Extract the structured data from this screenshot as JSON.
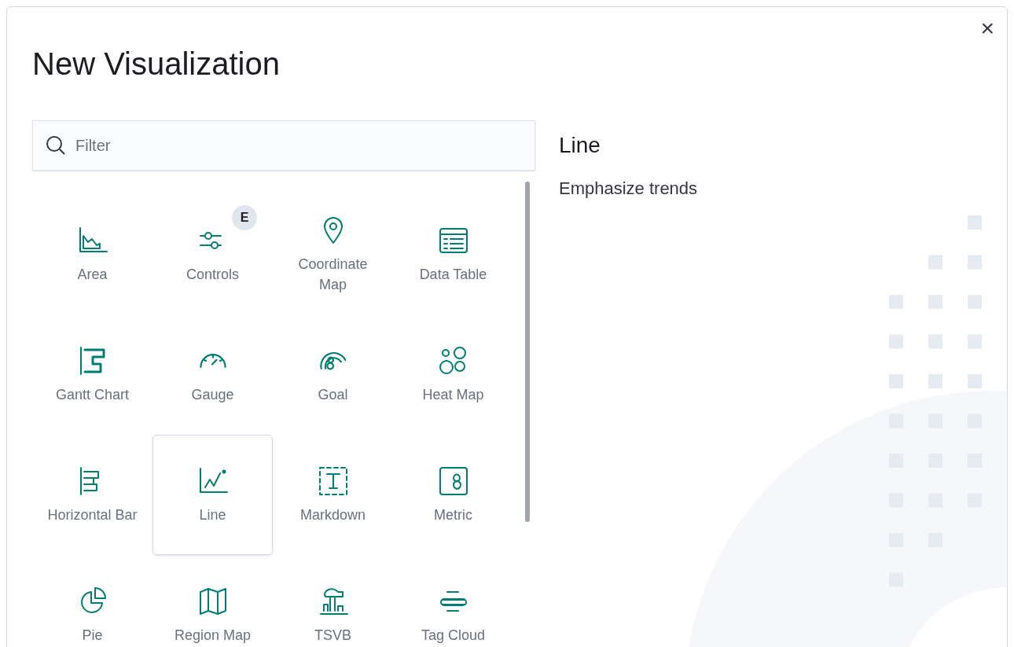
{
  "dialog": {
    "title": "New Visualization",
    "close_label": "×"
  },
  "filter": {
    "placeholder": "Filter"
  },
  "items": [
    {
      "label": "Area",
      "selected": false
    },
    {
      "label": "Controls",
      "selected": false,
      "badge": "E"
    },
    {
      "label": "Coordinate Map",
      "selected": false
    },
    {
      "label": "Data Table",
      "selected": false
    },
    {
      "label": "Gantt Chart",
      "selected": false
    },
    {
      "label": "Gauge",
      "selected": false
    },
    {
      "label": "Goal",
      "selected": false
    },
    {
      "label": "Heat Map",
      "selected": false
    },
    {
      "label": "Horizontal Bar",
      "selected": false
    },
    {
      "label": "Line",
      "selected": true
    },
    {
      "label": "Markdown",
      "selected": false
    },
    {
      "label": "Metric",
      "selected": false
    },
    {
      "label": "Pie",
      "selected": false
    },
    {
      "label": "Region Map",
      "selected": false
    },
    {
      "label": "TSVB",
      "selected": false
    },
    {
      "label": "Tag Cloud",
      "selected": false
    }
  ],
  "description": {
    "title": "Line",
    "text": "Emphasize trends"
  }
}
